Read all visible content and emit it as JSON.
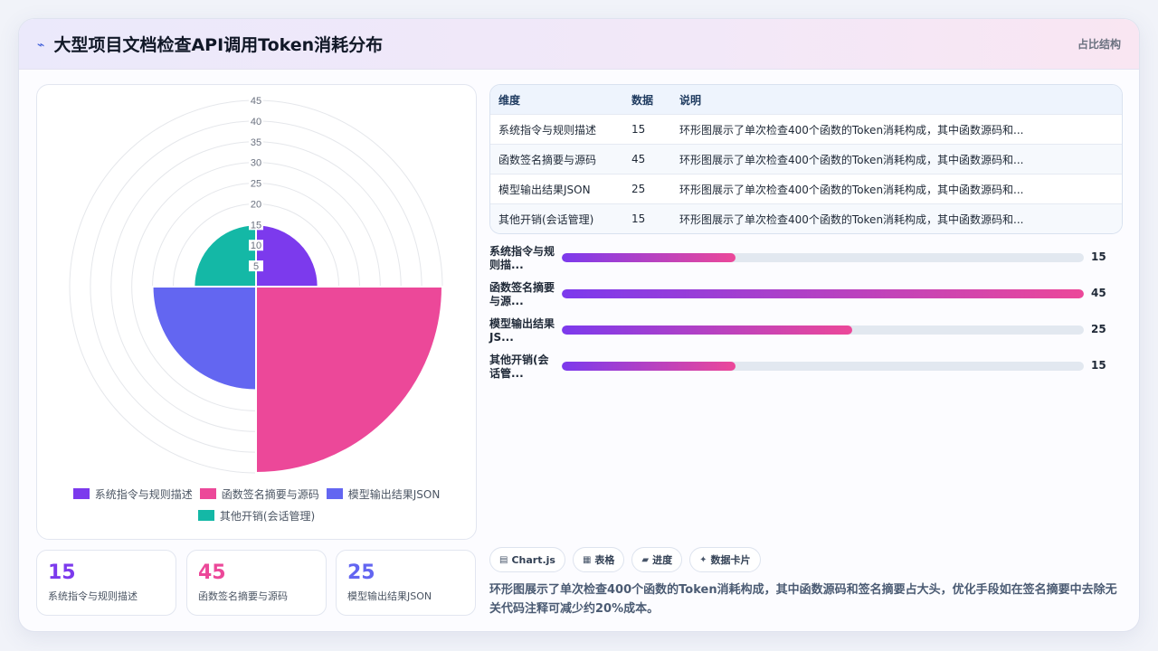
{
  "header": {
    "icon": "wave-icon",
    "icon_glyph": "⌁",
    "title": "大型项目文档检查API调用Token消耗分布",
    "tag": "占比结构"
  },
  "chart_data": {
    "type": "polarArea",
    "categories": [
      "系统指令与规则描述",
      "函数签名摘要与源码",
      "模型输出结果JSON",
      "其他开销(会话管理)"
    ],
    "values": [
      15,
      45,
      25,
      15
    ],
    "colors": [
      "#7c3aed",
      "#ec4899",
      "#6366f1",
      "#14b8a6"
    ],
    "r_ticks": [
      "5",
      "10",
      "15",
      "20",
      "25",
      "30",
      "35",
      "40",
      "45"
    ],
    "rlim": [
      0,
      45
    ],
    "grid": true,
    "legend": "bottom"
  },
  "stats": [
    {
      "value": "15",
      "label": "系统指令与规则描述",
      "color": "#7c3aed"
    },
    {
      "value": "45",
      "label": "函数签名摘要与源码",
      "color": "#ec4899"
    },
    {
      "value": "25",
      "label": "模型输出结果JSON",
      "color": "#6366f1"
    }
  ],
  "table": {
    "headers": [
      "维度",
      "数据",
      "说明"
    ],
    "rows": [
      {
        "dim": "系统指令与规则描述",
        "val": "15",
        "note": "环形图展示了单次检查400个函数的Token消耗构成，其中函数源码和..."
      },
      {
        "dim": "函数签名摘要与源码",
        "val": "45",
        "note": "环形图展示了单次检查400个函数的Token消耗构成，其中函数源码和..."
      },
      {
        "dim": "模型输出结果JSON",
        "val": "25",
        "note": "环形图展示了单次检查400个函数的Token消耗构成，其中函数源码和..."
      },
      {
        "dim": "其他开销(会话管理)",
        "val": "15",
        "note": "环形图展示了单次检查400个函数的Token消耗构成，其中函数源码和..."
      }
    ]
  },
  "bars": {
    "max": 45,
    "items": [
      {
        "label": "系统指令与规则描...",
        "value": 15
      },
      {
        "label": "函数签名摘要与源...",
        "value": 45
      },
      {
        "label": "模型输出结果JS...",
        "value": 25
      },
      {
        "label": "其他开销(会话管...",
        "value": 15
      }
    ]
  },
  "chips": [
    {
      "icon": "chart-icon",
      "glyph": "▤",
      "label": "Chart.js"
    },
    {
      "icon": "table-icon",
      "glyph": "▦",
      "label": "表格"
    },
    {
      "icon": "progress-icon",
      "glyph": "▰",
      "label": "进度"
    },
    {
      "icon": "sparkle-icon",
      "glyph": "✦",
      "label": "数据卡片"
    }
  ],
  "description": "环形图展示了单次检查400个函数的Token消耗构成，其中函数源码和签名摘要占大头，优化手段如在签名摘要中去除无关代码注释可减少约20%成本。"
}
